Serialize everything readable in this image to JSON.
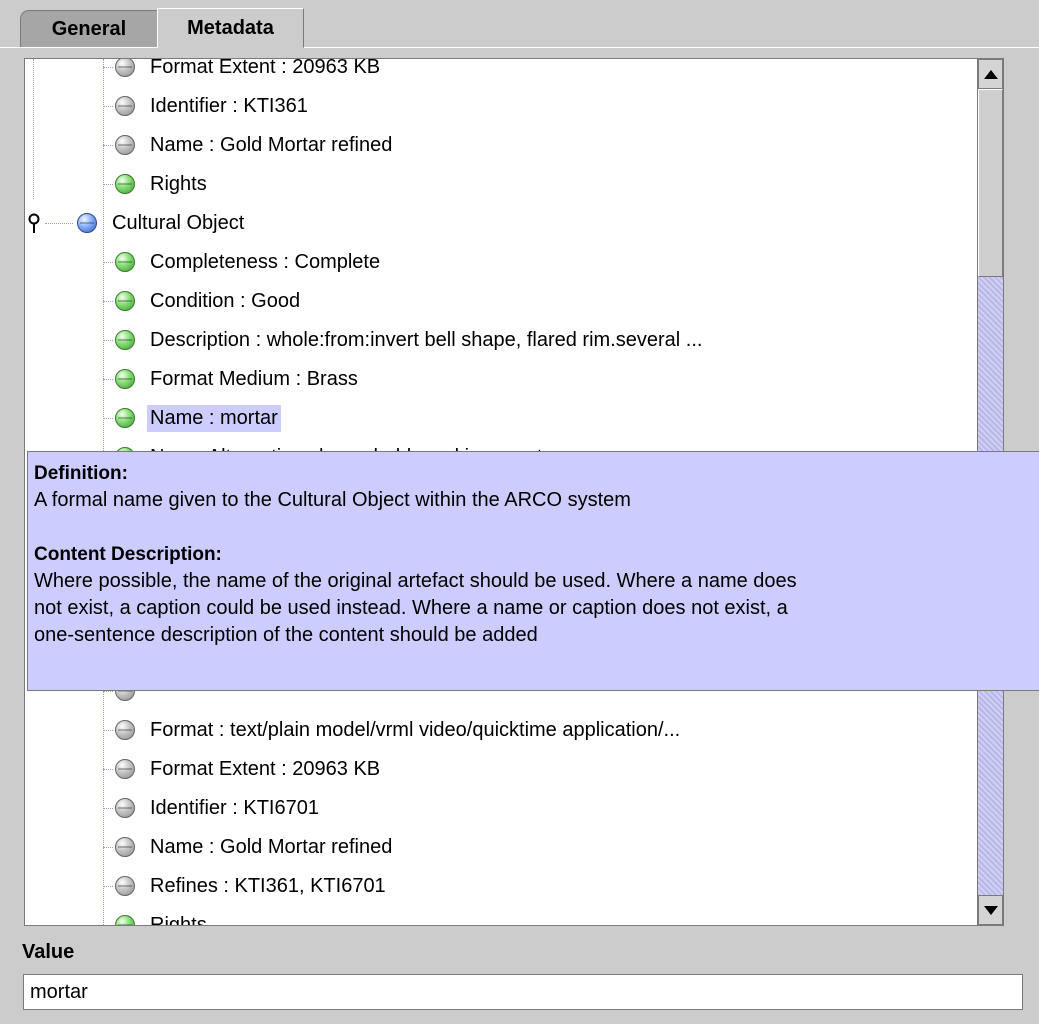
{
  "tabs": [
    {
      "label": "General",
      "selected": false
    },
    {
      "label": "Metadata",
      "selected": true
    }
  ],
  "tree": {
    "rows": [
      {
        "label": "Format Extent : 20963 KB",
        "ball": "gray",
        "level": 2
      },
      {
        "label": "Identifier : KTI361",
        "ball": "gray",
        "level": 2
      },
      {
        "label": "Name : Gold Mortar refined",
        "ball": "gray",
        "level": 2
      },
      {
        "label": "Rights",
        "ball": "green",
        "level": 2
      },
      {
        "label": "Cultural Object",
        "ball": "blue",
        "level": 1,
        "expanded": true
      },
      {
        "label": "Completeness : Complete",
        "ball": "green",
        "level": 2
      },
      {
        "label": "Condition : Good",
        "ball": "green",
        "level": 2
      },
      {
        "label": "Description : whole:from:invert bell shape, flared rim.several ...",
        "ball": "green",
        "level": 2
      },
      {
        "label": "Format Medium : Brass",
        "ball": "green",
        "level": 2
      },
      {
        "label": "Name : mortar",
        "ball": "green",
        "level": 2,
        "selected": true
      },
      {
        "label": "Name Alternative : household, cooking, mortar",
        "ball": "green",
        "level": 2
      },
      {
        "label": "",
        "ball": "gray",
        "level": 2
      },
      {
        "label": "",
        "ball": "gray",
        "level": 2
      },
      {
        "label": "",
        "ball": "gray",
        "level": 2
      },
      {
        "label": "",
        "ball": "gray",
        "level": 2
      },
      {
        "label": "",
        "ball": "gray",
        "level": 2
      },
      {
        "label": "",
        "ball": "gray",
        "level": 2
      },
      {
        "label": "Format : text/plain model/vrml video/quicktime application/...",
        "ball": "gray",
        "level": 2
      },
      {
        "label": "Format Extent : 20963 KB",
        "ball": "gray",
        "level": 2
      },
      {
        "label": "Identifier : KTI6701",
        "ball": "gray",
        "level": 2
      },
      {
        "label": "Name : Gold Mortar refined",
        "ball": "gray",
        "level": 2
      },
      {
        "label": "Refines : KTI361, KTI6701",
        "ball": "gray",
        "level": 2
      },
      {
        "label": "Rights",
        "ball": "green",
        "level": 2
      }
    ]
  },
  "tooltip": {
    "definition_heading": "Definition:",
    "definition_text": "A formal name given to the Cultural Object within the ARCO system",
    "content_heading": "Content Description:",
    "content_line1": "Where possible, the name of the original artefact should be used. Where a name does",
    "content_line2": "not exist, a caption could be used instead. Where a name or caption does not exist, a",
    "content_line3": "one-sentence description of the content should be added"
  },
  "value": {
    "label": "Value",
    "text": "mortar"
  }
}
